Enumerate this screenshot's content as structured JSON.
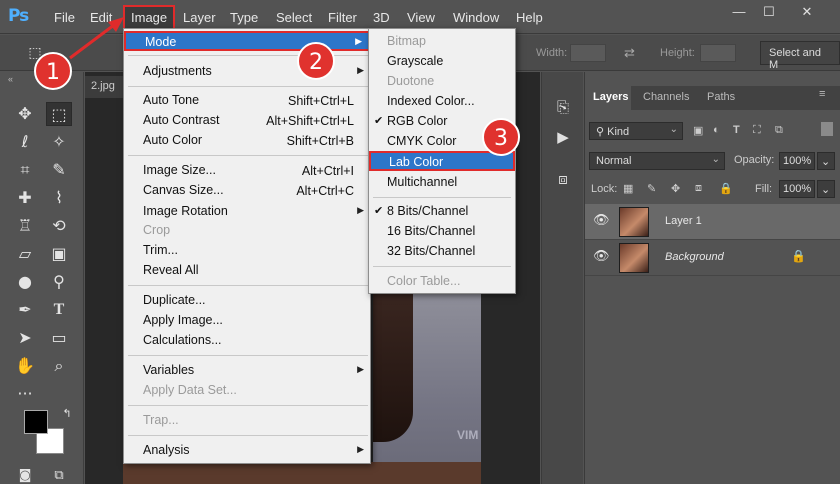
{
  "app": {
    "logo": "Ps"
  },
  "menubar": {
    "items": [
      "File",
      "Edit",
      "Image",
      "Layer",
      "Type",
      "Select",
      "Filter",
      "3D",
      "View",
      "Window",
      "Help"
    ],
    "window_controls": [
      "—",
      "☐",
      "✕"
    ]
  },
  "options": {
    "width_label": "Width:",
    "height_label": "Height:",
    "select_mask": "Select and M"
  },
  "document": {
    "tab": "2.jpg",
    "watermark": "VIM"
  },
  "image_menu": {
    "items": [
      {
        "label": "Mode",
        "submenu": true
      },
      {
        "label": "Adjustments",
        "submenu": true
      },
      {
        "label": "Auto Tone",
        "shortcut": "Shift+Ctrl+L"
      },
      {
        "label": "Auto Contrast",
        "shortcut": "Alt+Shift+Ctrl+L"
      },
      {
        "label": "Auto Color",
        "shortcut": "Shift+Ctrl+B"
      },
      {
        "label": "Image Size...",
        "shortcut": "Alt+Ctrl+I"
      },
      {
        "label": "Canvas Size...",
        "shortcut": "Alt+Ctrl+C"
      },
      {
        "label": "Image Rotation",
        "submenu": true
      },
      {
        "label": "Crop"
      },
      {
        "label": "Trim..."
      },
      {
        "label": "Reveal All"
      },
      {
        "label": "Duplicate..."
      },
      {
        "label": "Apply Image..."
      },
      {
        "label": "Calculations..."
      },
      {
        "label": "Variables",
        "submenu": true
      },
      {
        "label": "Apply Data Set..."
      },
      {
        "label": "Trap..."
      },
      {
        "label": "Analysis",
        "submenu": true
      }
    ]
  },
  "mode_submenu": {
    "items": [
      {
        "label": "Bitmap"
      },
      {
        "label": "Grayscale"
      },
      {
        "label": "Duotone"
      },
      {
        "label": "Indexed Color..."
      },
      {
        "label": "RGB Color"
      },
      {
        "label": "CMYK Color"
      },
      {
        "label": "Lab Color"
      },
      {
        "label": "Multichannel"
      },
      {
        "label": "8 Bits/Channel"
      },
      {
        "label": "16 Bits/Channel"
      },
      {
        "label": "32 Bits/Channel"
      },
      {
        "label": "Color Table..."
      }
    ]
  },
  "steps": [
    "1",
    "2",
    "3"
  ],
  "layers_panel": {
    "tabs": [
      "Layers",
      "Channels",
      "Paths"
    ],
    "kind": "Kind",
    "blend_mode": "Normal",
    "opacity_label": "Opacity:",
    "opacity": "100%",
    "lock_label": "Lock:",
    "fill_label": "Fill:",
    "fill": "100%",
    "layers": [
      {
        "name": "Layer 1"
      },
      {
        "name": "Background"
      }
    ]
  },
  "colors": {
    "highlight": "#2d76c9",
    "annotation": "#e02b2b"
  }
}
